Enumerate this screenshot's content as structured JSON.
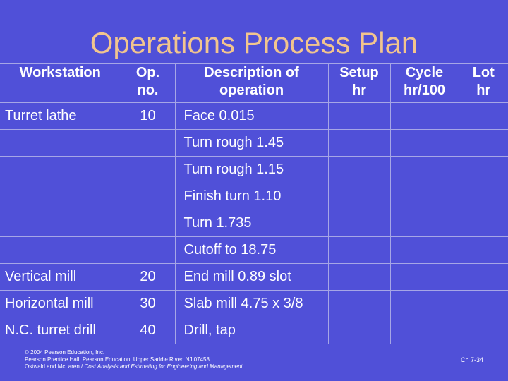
{
  "title": "Operations Process Plan",
  "table": {
    "headers": [
      {
        "line1": "Workstation",
        "line2": ""
      },
      {
        "line1": "Op.",
        "line2": "no."
      },
      {
        "line1": "Description of",
        "line2": "operation"
      },
      {
        "line1": "Setup",
        "line2": "hr"
      },
      {
        "line1": "Cycle",
        "line2": "hr/100"
      },
      {
        "line1": "Lot",
        "line2": "hr"
      }
    ],
    "rows": [
      {
        "workstation": "Turret lathe",
        "op_no": "10",
        "description": "Face 0.015",
        "setup_hr": "",
        "cycle_hr_100": "",
        "lot_hr": ""
      },
      {
        "workstation": "",
        "op_no": "",
        "description": "Turn rough 1.45",
        "setup_hr": "",
        "cycle_hr_100": "",
        "lot_hr": ""
      },
      {
        "workstation": "",
        "op_no": "",
        "description": "Turn rough 1.15",
        "setup_hr": "",
        "cycle_hr_100": "",
        "lot_hr": ""
      },
      {
        "workstation": "",
        "op_no": "",
        "description": "Finish turn 1.10",
        "setup_hr": "",
        "cycle_hr_100": "",
        "lot_hr": ""
      },
      {
        "workstation": "",
        "op_no": "",
        "description": "Turn 1.735",
        "setup_hr": "",
        "cycle_hr_100": "",
        "lot_hr": ""
      },
      {
        "workstation": "",
        "op_no": "",
        "description": "Cutoff to 18.75",
        "setup_hr": "",
        "cycle_hr_100": "",
        "lot_hr": ""
      },
      {
        "workstation": "Vertical mill",
        "op_no": "20",
        "description": "End mill 0.89 slot",
        "setup_hr": "",
        "cycle_hr_100": "",
        "lot_hr": ""
      },
      {
        "workstation": "Horizontal mill",
        "op_no": "30",
        "description": "Slab mill 4.75 x 3/8",
        "setup_hr": "",
        "cycle_hr_100": "",
        "lot_hr": ""
      },
      {
        "workstation": "N.C. turret drill",
        "op_no": "40",
        "description": "Drill, tap",
        "setup_hr": "",
        "cycle_hr_100": "",
        "lot_hr": ""
      }
    ]
  },
  "footer": {
    "line1": "© 2004 Pearson Education, Inc.",
    "line2": "Pearson Prentice Hall, Pearson Education, Upper Saddle River, NJ 07458",
    "line3_authors": "Ostwald and McLaren / ",
    "line3_title": "Cost Analysis and Estimating for Engineering and Management"
  },
  "page_number": "Ch 7-34",
  "colors": {
    "background": "#5050d8",
    "title": "#f2c58e",
    "text": "#ffffff",
    "grid": "#a6a6e6"
  }
}
